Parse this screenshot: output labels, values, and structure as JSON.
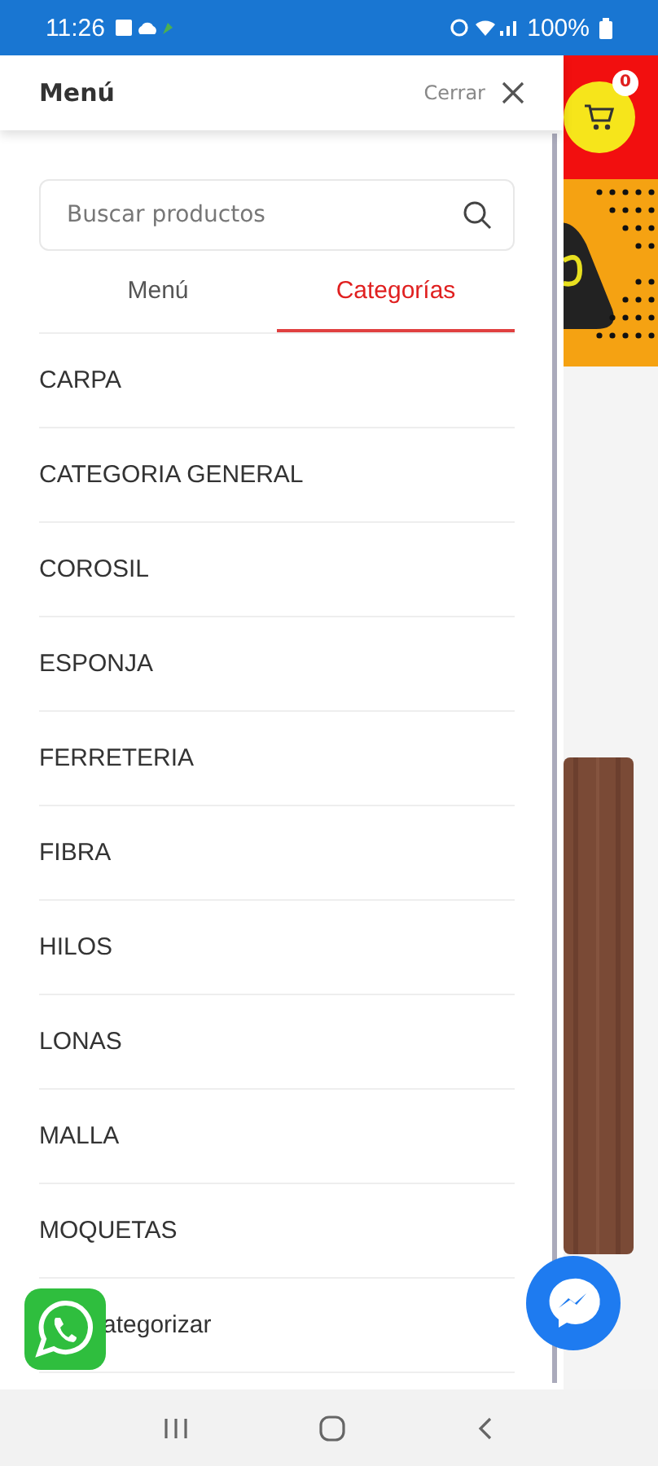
{
  "status_bar": {
    "time": "11:26",
    "battery": "100%"
  },
  "drawer": {
    "title": "Menú",
    "close_label": "Cerrar",
    "search": {
      "placeholder": "Buscar productos"
    },
    "tabs": [
      {
        "label": "Menú",
        "selected": false
      },
      {
        "label": "Categorías",
        "selected": true
      }
    ],
    "categories": [
      {
        "label": "CARPA",
        "kind": "row"
      },
      {
        "label": "CATEGORIA GENERAL",
        "kind": "row"
      },
      {
        "label": "COROSIL",
        "kind": "row"
      },
      {
        "label": "ESPONJA",
        "kind": "row"
      },
      {
        "label": "FERRETERIA",
        "kind": "row"
      },
      {
        "label": "FIBRA",
        "kind": "row"
      },
      {
        "label": "HILOS",
        "kind": "row"
      },
      {
        "label": "LONAS",
        "kind": "row"
      },
      {
        "label": "MALLA",
        "kind": "row"
      },
      {
        "label": "MOQUETAS",
        "kind": "row"
      },
      {
        "label": "ategorizar",
        "kind": "covered"
      }
    ]
  },
  "cart": {
    "count": "0"
  }
}
